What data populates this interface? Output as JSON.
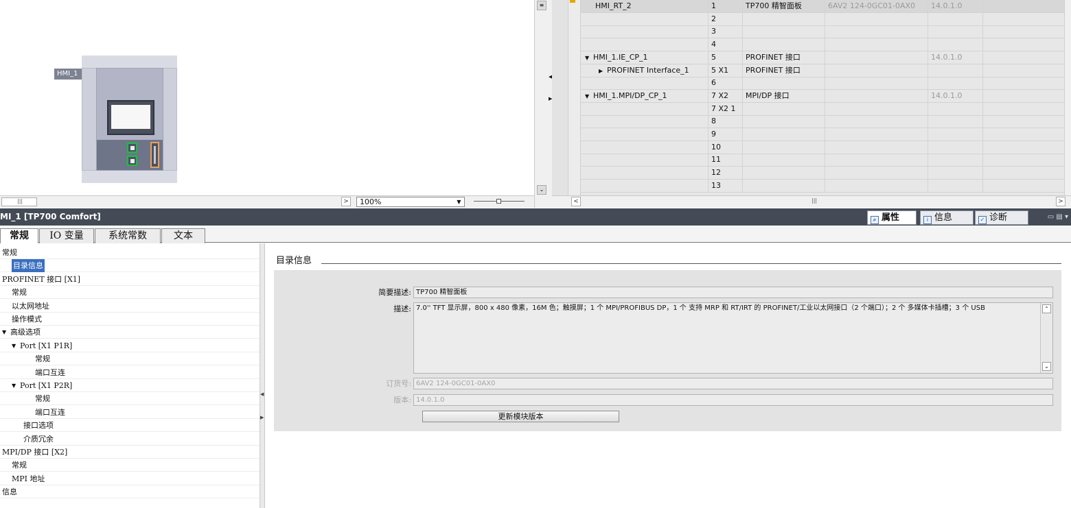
{
  "device_view": {
    "device_label": "HMI_1",
    "zoom_value": "100%"
  },
  "overview_table": {
    "rows": [
      {
        "module": "HMI_RT_2",
        "slot": "1",
        "type": "TP700 精智面板",
        "order": "6AV2 124-0GC01-0AX0",
        "version": "14.0.1.0",
        "indent": 1,
        "caret": ""
      },
      {
        "module": "",
        "slot": "2",
        "type": "",
        "order": "",
        "version": "",
        "indent": 0,
        "caret": ""
      },
      {
        "module": "",
        "slot": "3",
        "type": "",
        "order": "",
        "version": "",
        "indent": 0,
        "caret": ""
      },
      {
        "module": "",
        "slot": "4",
        "type": "",
        "order": "",
        "version": "",
        "indent": 0,
        "caret": ""
      },
      {
        "module": "HMI_1.IE_CP_1",
        "slot": "5",
        "type": "PROFINET 接口",
        "order": "",
        "version": "14.0.1.0",
        "indent": 0,
        "caret": "▼"
      },
      {
        "module": "PROFINET Interface_1",
        "slot": "5 X1",
        "type": "PROFINET 接口",
        "order": "",
        "version": "",
        "indent": 1,
        "caret": "▶"
      },
      {
        "module": "",
        "slot": "6",
        "type": "",
        "order": "",
        "version": "",
        "indent": 0,
        "caret": ""
      },
      {
        "module": "HMI_1.MPI/DP_CP_1",
        "slot": "7 X2",
        "type": "MPI/DP 接口",
        "order": "",
        "version": "14.0.1.0",
        "indent": 0,
        "caret": "▼"
      },
      {
        "module": "",
        "slot": "7 X2 1",
        "type": "",
        "order": "",
        "version": "",
        "indent": 0,
        "caret": ""
      },
      {
        "module": "",
        "slot": "8",
        "type": "",
        "order": "",
        "version": "",
        "indent": 0,
        "caret": ""
      },
      {
        "module": "",
        "slot": "9",
        "type": "",
        "order": "",
        "version": "",
        "indent": 0,
        "caret": ""
      },
      {
        "module": "",
        "slot": "10",
        "type": "",
        "order": "",
        "version": "",
        "indent": 0,
        "caret": ""
      },
      {
        "module": "",
        "slot": "11",
        "type": "",
        "order": "",
        "version": "",
        "indent": 0,
        "caret": ""
      },
      {
        "module": "",
        "slot": "12",
        "type": "",
        "order": "",
        "version": "",
        "indent": 0,
        "caret": ""
      },
      {
        "module": "",
        "slot": "13",
        "type": "",
        "order": "",
        "version": "",
        "indent": 0,
        "caret": ""
      }
    ]
  },
  "inspector": {
    "title": "MI_1 [TP700 Comfort]",
    "tabs": [
      {
        "label": "属性",
        "icon": "properties-icon"
      },
      {
        "label": "信息",
        "icon": "info-icon"
      },
      {
        "label": "诊断",
        "icon": "diagnostics-icon"
      }
    ]
  },
  "property_tabs": [
    "常规",
    "IO 变量",
    "系统常数",
    "文本"
  ],
  "nav_tree": [
    {
      "label": "常规",
      "caret": ""
    },
    {
      "label": "目录信息",
      "caret": "",
      "selected": true
    },
    {
      "label": "PROFINET 接口 [X1]",
      "caret": ""
    },
    {
      "label": "常规",
      "caret": ""
    },
    {
      "label": "以太网地址",
      "caret": ""
    },
    {
      "label": "操作模式",
      "caret": ""
    },
    {
      "label": "高级选项",
      "caret": "▼"
    },
    {
      "label": "Port [X1 P1R]",
      "caret": "▼"
    },
    {
      "label": "常规",
      "caret": ""
    },
    {
      "label": "端口互连",
      "caret": ""
    },
    {
      "label": "Port [X1 P2R]",
      "caret": "▼"
    },
    {
      "label": "常规",
      "caret": ""
    },
    {
      "label": "端口互连",
      "caret": ""
    },
    {
      "label": "接口选项",
      "caret": ""
    },
    {
      "label": "介质冗余",
      "caret": ""
    },
    {
      "label": "MPI/DP 接口 [X2]",
      "caret": ""
    },
    {
      "label": "常规",
      "caret": ""
    },
    {
      "label": "MPI 地址",
      "caret": ""
    },
    {
      "label": "信息",
      "caret": ""
    }
  ],
  "catalog": {
    "section_title": "目录信息",
    "short_desc_label": "简要描述:",
    "short_desc_value": "TP700 精智面板",
    "desc_label": "描述:",
    "desc_value": "7.0'' TFT 显示屏，800 x 480 像素，16M 色；触摸屏；1 个 MPI/PROFIBUS DP，1 个 支持 MRP 和 RT/IRT 的 PROFINET/工业以太网接口（2 个端口）；2 个 多媒体卡插槽；3 个 USB",
    "order_label": "订货号:",
    "order_value": "6AV2 124-0GC01-0AX0",
    "version_label": "版本:",
    "version_value": "14.0.1.0",
    "update_button": "更新模块版本"
  }
}
